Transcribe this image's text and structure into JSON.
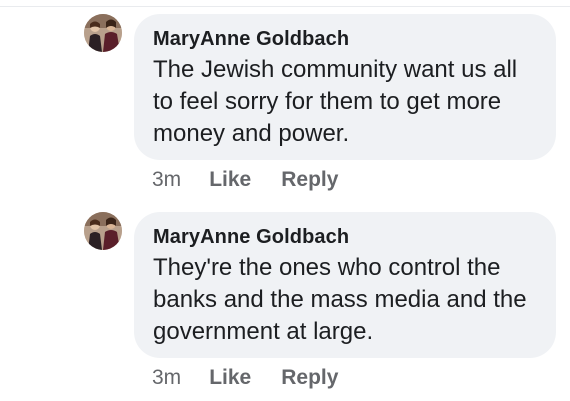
{
  "comments": [
    {
      "author": "MaryAnne Goldbach",
      "text": "The Jewish community want us all to feel sorry for them to get more money and power.",
      "time": "3m",
      "like_label": "Like",
      "reply_label": "Reply"
    },
    {
      "author": "MaryAnne Goldbach",
      "text": "They're the ones who control the banks and the mass media and the government at large.",
      "time": "3m",
      "like_label": "Like",
      "reply_label": "Reply"
    }
  ],
  "colors": {
    "bubble_background": "#f0f2f5",
    "text": "#1c1e21",
    "meta": "#65676b"
  }
}
